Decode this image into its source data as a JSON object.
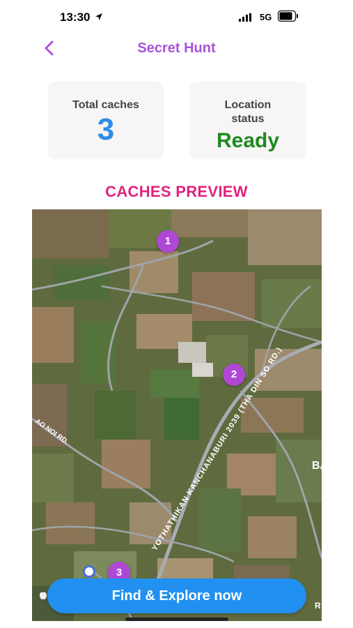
{
  "status_bar": {
    "time": "13:30",
    "network": "5G"
  },
  "header": {
    "title": "Secret Hunt"
  },
  "stats": {
    "total_label": "Total caches",
    "total_value": "3",
    "location_label": "Location status",
    "location_value": "Ready"
  },
  "section": {
    "title": "CACHES PREVIEW"
  },
  "map": {
    "markers": [
      "1",
      "2",
      "3"
    ],
    "road_labels": [
      "YOTHATHIKAN KANCHANABURI 2039 (THA DIN SO RD.)",
      "AO NOI RD.",
      "BA",
      "R"
    ]
  },
  "actions": {
    "primary_label": "Find & Explore now"
  },
  "colors": {
    "title": "#a952d9",
    "section_title": "#e0237d",
    "count": "#2c8de6",
    "status": "#1f8a1f",
    "marker": "#b048d6",
    "button": "#2190f0"
  }
}
